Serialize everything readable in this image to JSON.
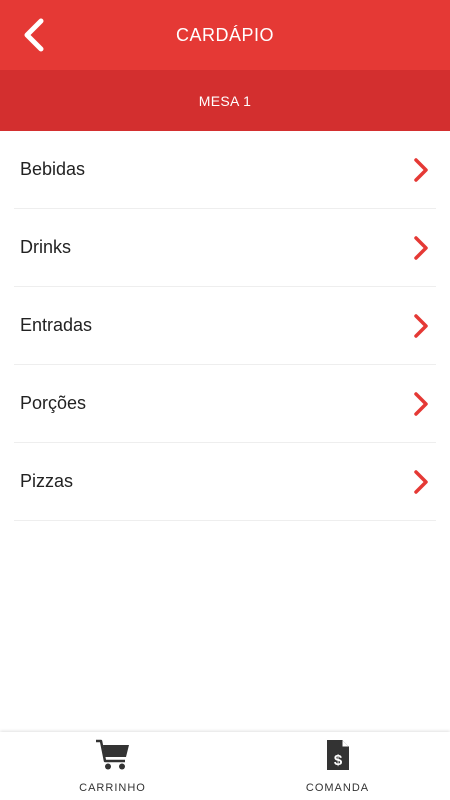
{
  "colors": {
    "header_bg": "#e53935",
    "subheader_bg": "#d32f2f",
    "accent": "#e53935",
    "text": "#222222"
  },
  "header": {
    "title": "CARDÁPIO",
    "back_icon": "chevron-left-icon"
  },
  "subheader": {
    "table_label": "MESA 1"
  },
  "menu": {
    "items": [
      {
        "label": "Bebidas",
        "icon": "chevron-right-icon"
      },
      {
        "label": "Drinks",
        "icon": "chevron-right-icon"
      },
      {
        "label": "Entradas",
        "icon": "chevron-right-icon"
      },
      {
        "label": "Porções",
        "icon": "chevron-right-icon"
      },
      {
        "label": "Pizzas",
        "icon": "chevron-right-icon"
      }
    ]
  },
  "bottom_nav": {
    "cart": {
      "label": "CARRINHO",
      "icon": "shopping-cart-icon"
    },
    "tab": {
      "label": "COMANDA",
      "icon": "receipt-dollar-icon"
    }
  }
}
